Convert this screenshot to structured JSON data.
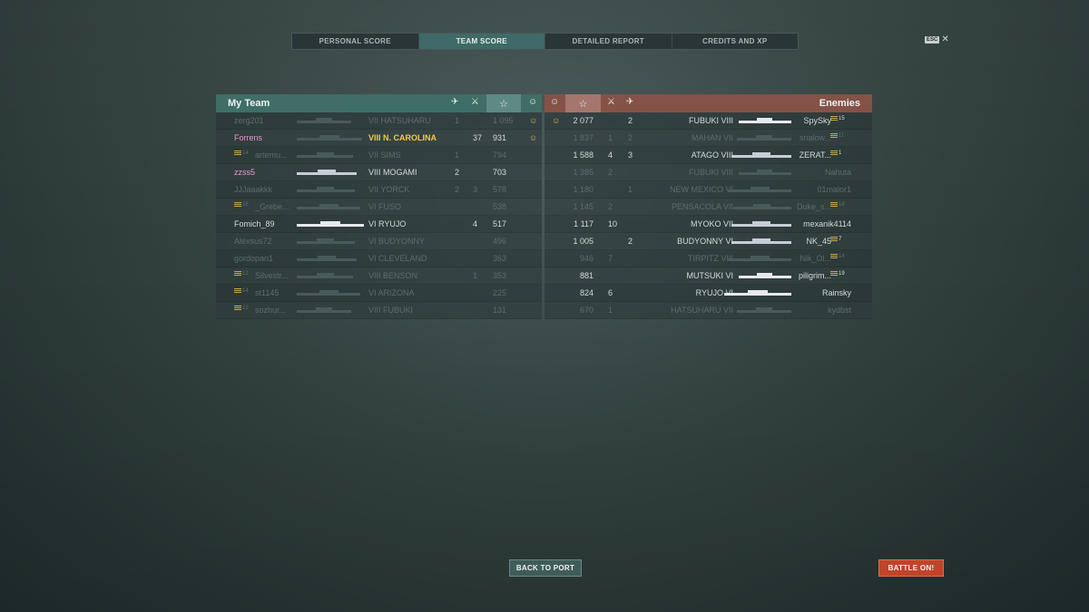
{
  "tabs": [
    "PERSONAL SCORE",
    "TEAM SCORE",
    "DETAILED REPORT",
    "CREDITS AND XP"
  ],
  "esc_label": "ESC",
  "my_team": {
    "title": "My Team",
    "rows": [
      {
        "player": "zerg201",
        "rank": "",
        "tier": "VII",
        "ship": "HATSUHARU",
        "planes": "1",
        "kills": "",
        "xp": "1 095",
        "face": "☺",
        "style": "dim",
        "sil": "dark",
        "w": 60
      },
      {
        "player": "Forrens",
        "rank": "",
        "tier": "VIII",
        "ship": "N. CAROLINA",
        "planes": "",
        "kills": "37",
        "xp": "931",
        "face": "☺",
        "style": "hl",
        "sil": "dark",
        "w": 72
      },
      {
        "player": "artemu...",
        "rank": "14",
        "tier": "VII",
        "ship": "SIMS",
        "planes": "1",
        "kills": "",
        "xp": "794",
        "face": "",
        "style": "dim",
        "sil": "dark",
        "w": 62
      },
      {
        "player": "zzss5",
        "rank": "",
        "tier": "VIII",
        "ship": "MOGAMI",
        "planes": "2",
        "kills": "",
        "xp": "703",
        "face": "",
        "style": "pink",
        "sil": "bright",
        "w": 66
      },
      {
        "player": "JJJaaakkk",
        "rank": "",
        "tier": "VII",
        "ship": "YORCK",
        "planes": "2",
        "kills": "3",
        "xp": "578",
        "face": "",
        "style": "dim",
        "sil": "dark",
        "w": 64
      },
      {
        "player": "_Grebe...",
        "rank": "18",
        "tier": "VI",
        "ship": "FUSO",
        "planes": "",
        "kills": "",
        "xp": "538",
        "face": "",
        "style": "dim",
        "sil": "dark",
        "w": 70
      },
      {
        "player": "Fomich_89",
        "rank": "",
        "tier": "VI",
        "ship": "RYUJO",
        "planes": "",
        "kills": "4",
        "xp": "517",
        "face": "",
        "style": "normal",
        "sil": "white",
        "w": 74
      },
      {
        "player": "Alexsus72",
        "rank": "",
        "tier": "VI",
        "ship": "BUDYONNY",
        "planes": "",
        "kills": "",
        "xp": "496",
        "face": "",
        "style": "dim",
        "sil": "dark",
        "w": 64
      },
      {
        "player": "gordopan1",
        "rank": "",
        "tier": "VI",
        "ship": "CLEVELAND",
        "planes": "",
        "kills": "",
        "xp": "363",
        "face": "",
        "style": "dim",
        "sil": "dark",
        "w": 66
      },
      {
        "player": "Silvestr...",
        "rank": "12",
        "tier": "VIII",
        "ship": "BENSON",
        "planes": "",
        "kills": "1",
        "xp": "353",
        "face": "",
        "style": "dim",
        "sil": "dark",
        "w": 62
      },
      {
        "player": "st1145",
        "rank": "14",
        "tier": "VI",
        "ship": "ARIZONA",
        "planes": "",
        "kills": "",
        "xp": "225",
        "face": "",
        "style": "dim",
        "sil": "dark",
        "w": 70
      },
      {
        "player": "sozhur...",
        "rank": "12",
        "tier": "VIII",
        "ship": "FUBUKI",
        "planes": "",
        "kills": "",
        "xp": "131",
        "face": "",
        "style": "dim",
        "sil": "dark",
        "w": 60
      }
    ]
  },
  "enemies": {
    "title": "Enemies",
    "rows": [
      {
        "face": "☺",
        "xp": "2 077",
        "kills": "",
        "planes": "2",
        "ship": "FUBUKI",
        "tier": "VIII",
        "player": "SpySky",
        "rank": "15",
        "style": "normal",
        "sil": "white",
        "w": 58
      },
      {
        "face": "",
        "xp": "1 837",
        "kills": "1",
        "planes": "2",
        "ship": "MAHAN",
        "tier": "VII",
        "player": "snalow...",
        "rank": "11",
        "style": "dim",
        "sil": "dark",
        "w": 60
      },
      {
        "face": "",
        "xp": "1 588",
        "kills": "4",
        "planes": "3",
        "ship": "ATAGO",
        "tier": "VIII",
        "player": "ZERAT...",
        "rank": "1",
        "style": "normal",
        "sil": "bright",
        "w": 66
      },
      {
        "face": "",
        "xp": "1 385",
        "kills": "2",
        "planes": "",
        "ship": "FUBUKI",
        "tier": "VIII",
        "player": "Nahuta",
        "rank": "",
        "style": "dim",
        "sil": "dark",
        "w": 58
      },
      {
        "face": "",
        "xp": "1 180",
        "kills": "",
        "planes": "1",
        "ship": "NEW MEXICO",
        "tier": "VI",
        "player": "01malor1",
        "rank": "",
        "style": "dim",
        "sil": "dark",
        "w": 70
      },
      {
        "face": "",
        "xp": "1 145",
        "kills": "2",
        "planes": "",
        "ship": "PENSACOLA",
        "tier": "VII",
        "player": "Duke_s...",
        "rank": "18",
        "style": "dim",
        "sil": "dark",
        "w": 64
      },
      {
        "face": "",
        "xp": "1 117",
        "kills": "10",
        "planes": "",
        "ship": "MYOKO",
        "tier": "VII",
        "player": "mexanik4114",
        "rank": "",
        "style": "normal",
        "sil": "bright",
        "w": 66
      },
      {
        "face": "",
        "xp": "1 005",
        "kills": "",
        "planes": "2",
        "ship": "BUDYONNY",
        "tier": "VI",
        "player": "NK_45",
        "rank": "7",
        "style": "normal",
        "sil": "bright",
        "w": 66
      },
      {
        "face": "",
        "xp": "946",
        "kills": "7",
        "planes": "",
        "ship": "TIRPITZ",
        "tier": "VIII",
        "player": "Nik_Ol...",
        "rank": "14",
        "style": "dim",
        "sil": "dark",
        "w": 70
      },
      {
        "face": "",
        "xp": "881",
        "kills": "",
        "planes": "",
        "ship": "MUTSUKI",
        "tier": "VI",
        "player": "piligrim...",
        "rank": "19",
        "style": "normal",
        "sil": "white",
        "w": 58
      },
      {
        "face": "",
        "xp": "824",
        "kills": "6",
        "planes": "",
        "ship": "RYUJO",
        "tier": "VI",
        "player": "Rainsky",
        "rank": "",
        "style": "normal",
        "sil": "white",
        "w": 74
      },
      {
        "face": "",
        "xp": "670",
        "kills": "1",
        "planes": "",
        "ship": "HATSUHARU",
        "tier": "VII",
        "player": "kydbst",
        "rank": "",
        "style": "dim",
        "sil": "dark",
        "w": 60
      }
    ]
  },
  "buttons": {
    "back_to_port": "BACK TO PORT",
    "battle_on": "BATTLE ON!"
  },
  "colors": {
    "team_header": "#3f6e66",
    "enemy_header": "#845247",
    "battle_button": "#c1432a",
    "highlight_ship": "#f3c94c",
    "highlight_player": "#e59bcf"
  },
  "icons": {
    "plane": "plane-icon",
    "kill": "crossed-swords-icon",
    "xp": "star-icon",
    "achievement": "smile-icon",
    "rank": "rank-chevron-icon"
  }
}
